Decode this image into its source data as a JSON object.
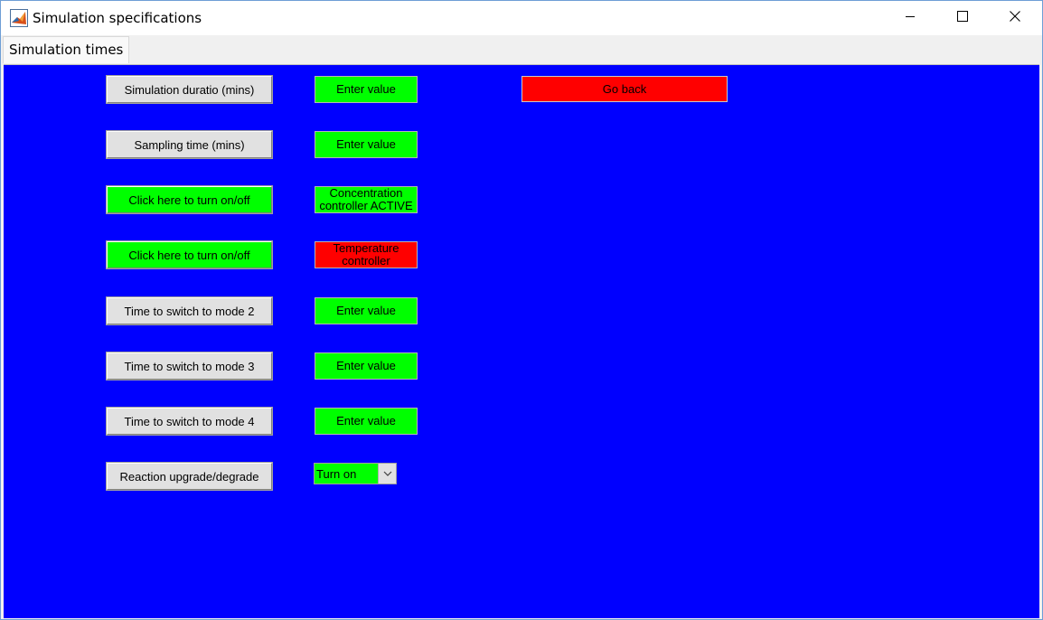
{
  "window": {
    "title": "Simulation specifications",
    "controls": {
      "minimize_icon": "minimize-icon",
      "maximize_icon": "maximize-icon",
      "close_icon": "close-icon"
    }
  },
  "tabs": [
    {
      "label": "Simulation times",
      "selected": true
    }
  ],
  "colors": {
    "panel_background": "#0000ff",
    "active_green": "#00ff00",
    "inactive_red": "#ff0000",
    "button_gray": "#e1e1e1"
  },
  "rows": [
    {
      "button_label": "Simulation duratio (mins)",
      "field_value": "Enter value"
    },
    {
      "button_label": "Sampling time (mins)",
      "field_value": "Enter value"
    },
    {
      "button_label": "Click here to turn on/off",
      "field_value": "Concentration controller ACTIVE"
    },
    {
      "button_label": "Click here to turn on/off",
      "field_value": "Temperature controller"
    },
    {
      "button_label": "Time to switch to mode 2",
      "field_value": "Enter value"
    },
    {
      "button_label": "Time to switch to mode 3",
      "field_value": "Enter value"
    },
    {
      "button_label": "Time to switch to mode 4",
      "field_value": "Enter value"
    },
    {
      "button_label": "Reaction upgrade/degrade",
      "select_value": "Turn on"
    }
  ],
  "go_back": {
    "label": "Go back"
  }
}
